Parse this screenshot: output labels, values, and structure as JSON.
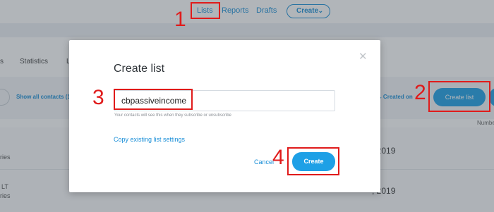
{
  "nav": {
    "lists": "Lists",
    "reports": "Reports",
    "drafts": "Drafts",
    "create": "Create",
    "create_chevron": "⌄"
  },
  "tabs": {
    "partial_s": "s",
    "statistics": "Statistics",
    "partial_l": "L"
  },
  "toolbar": {
    "show_all": "Show all contacts (1(",
    "created_on": "⇅ Created on",
    "create_list": "Create list"
  },
  "table": {
    "number_header": "Numbe",
    "row1_text": "ries",
    "row1_year": ", 2019",
    "row2_lt": "LT",
    "row2_ries": "ries",
    "row2_year": ", 2019"
  },
  "modal": {
    "close": "✕",
    "title": "Create list",
    "name_value": "cbpassiveincome",
    "hint": "Your contacts will see this when they subscribe or unsubscribe",
    "copy_settings": "Copy existing list settings",
    "cancel": "Cancel",
    "create": "Create"
  },
  "annotations": [
    "1",
    "2",
    "3",
    "4"
  ],
  "colors": {
    "accent": "#1ea0e6",
    "link": "#1a8fd8",
    "annotation": "#e01b1b"
  }
}
